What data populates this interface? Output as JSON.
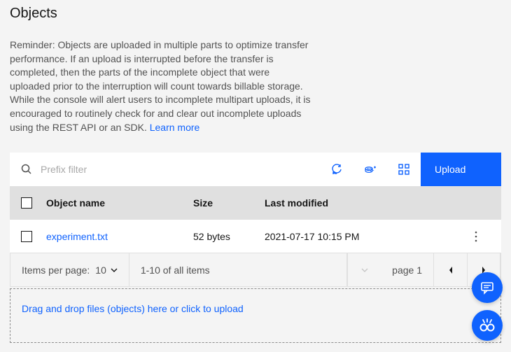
{
  "page": {
    "title": "Objects",
    "reminder_text": "Reminder: Objects are uploaded in multiple parts to optimize transfer performance. If an upload is interrupted before the transfer is completed, then the parts of the incomplete object that were uploaded prior to the interruption will count towards billable storage. While the console will alert users to incomplete multipart uploads, it is encouraged to routinely check for and clear out incomplete uploads using the REST API or an SDK.",
    "learn_more": "Learn more"
  },
  "toolbar": {
    "search_placeholder": "Prefix filter",
    "upload_label": "Upload"
  },
  "table": {
    "headers": {
      "name": "Object name",
      "size": "Size",
      "modified": "Last modified"
    },
    "rows": [
      {
        "name": "experiment.txt",
        "size": "52 bytes",
        "modified": "2021-07-17 10:15 PM"
      }
    ]
  },
  "pagination": {
    "items_per_page_label": "Items per page:",
    "items_per_page_value": "10",
    "range_text": "1-10 of all items",
    "page_label": "page 1"
  },
  "dropzone": {
    "text": "Drag and drop files (objects) here or click to upload"
  }
}
